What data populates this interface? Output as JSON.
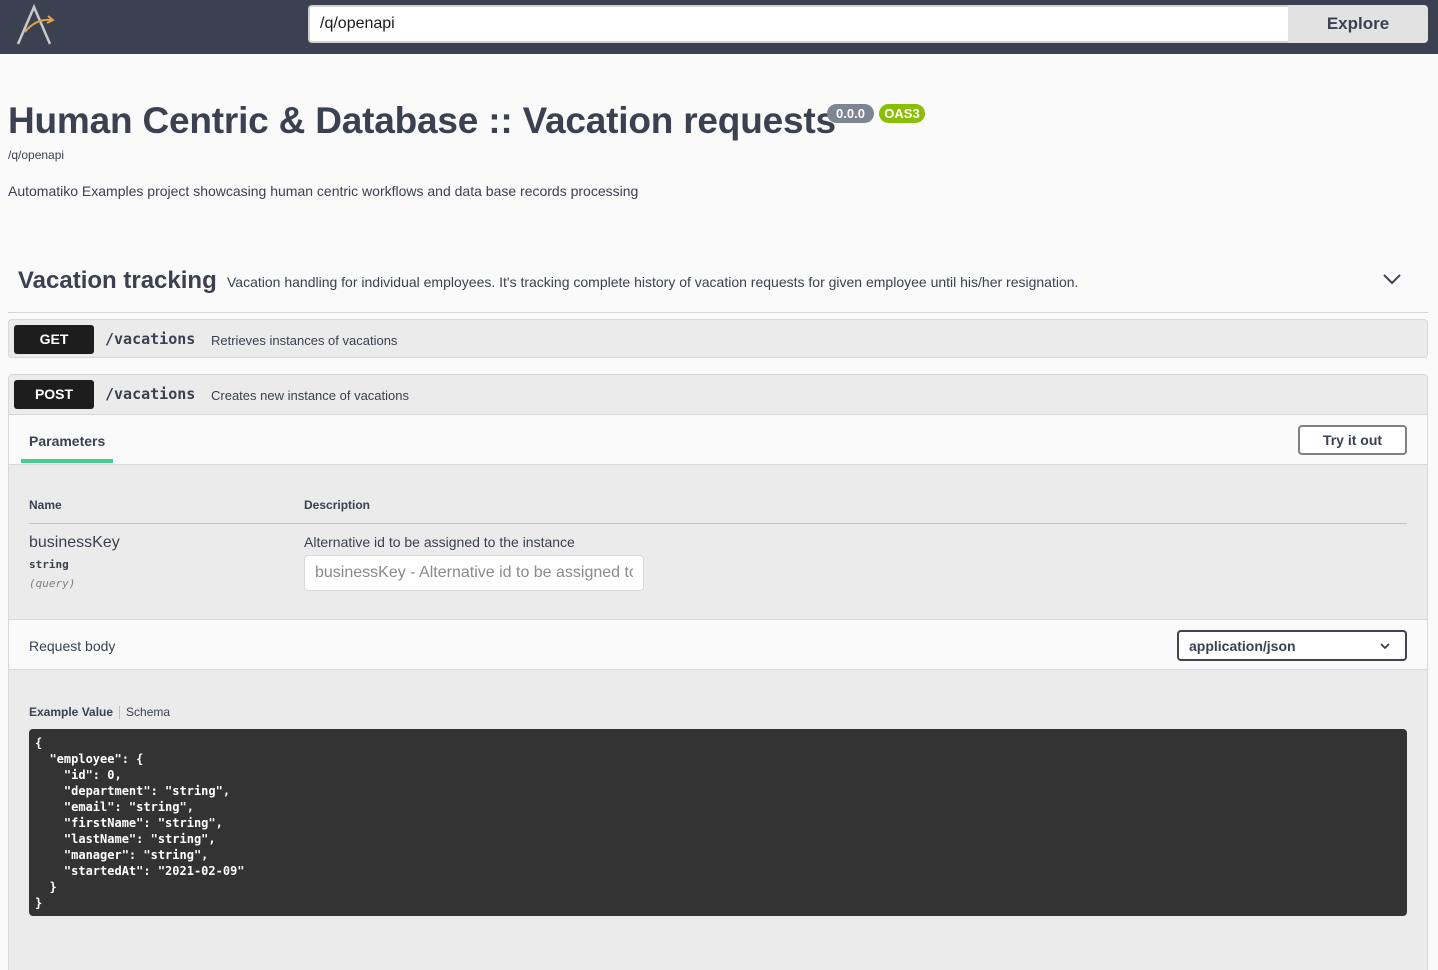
{
  "topbar": {
    "url_value": "/q/openapi",
    "explore_label": "Explore"
  },
  "info": {
    "title": "Human Centric & Database :: Vacation requests",
    "version": "0.0.0",
    "oas_badge": "OAS3",
    "spec_url": "/q/openapi",
    "description": "Automatiko Examples project showcasing human centric workflows and data base records processing"
  },
  "tag": {
    "name": "Vacation tracking",
    "description": "Vacation handling for individual employees. It's tracking complete history of vacation requests for given employee until his/her resignation."
  },
  "operations": [
    {
      "method": "GET",
      "path": "/vacations",
      "summary": "Retrieves instances of vacations"
    },
    {
      "method": "POST",
      "path": "/vacations",
      "summary": "Creates new instance of vacations",
      "parameters_tab": "Parameters",
      "try_it_out": "Try it out",
      "columns": {
        "name": "Name",
        "description": "Description"
      },
      "param": {
        "name": "businessKey",
        "type": "string",
        "in": "(query)",
        "description": "Alternative id to be assigned to the instance",
        "placeholder": "businessKey - Alternative id to be assigned to the instance"
      },
      "request_body_label": "Request body",
      "content_type": "application/json",
      "example_tabs": {
        "example": "Example Value",
        "schema": "Schema"
      },
      "example_lines": [
        "{",
        "  \"employee\": {",
        "    \"id\": 0,",
        "    \"department\": \"string\",",
        "    \"email\": \"string\",",
        "    \"firstName\": \"string\",",
        "    \"lastName\": \"string\",",
        "    \"manager\": \"string\",",
        "    \"startedAt\": \"2021-02-09\"",
        "  }",
        "}"
      ]
    }
  ],
  "colors": {
    "topbar": "#3b4151",
    "method_bg": "#1d1d1d",
    "version_badge": "#7d8492",
    "oas_badge": "#89bf04",
    "tab_underline": "#49cc90",
    "code_bg": "#333333"
  },
  "icons": {
    "logo": "automatiko-logo",
    "tag_toggle": "chevron-down-icon",
    "select_toggle": "chevron-down-icon"
  }
}
